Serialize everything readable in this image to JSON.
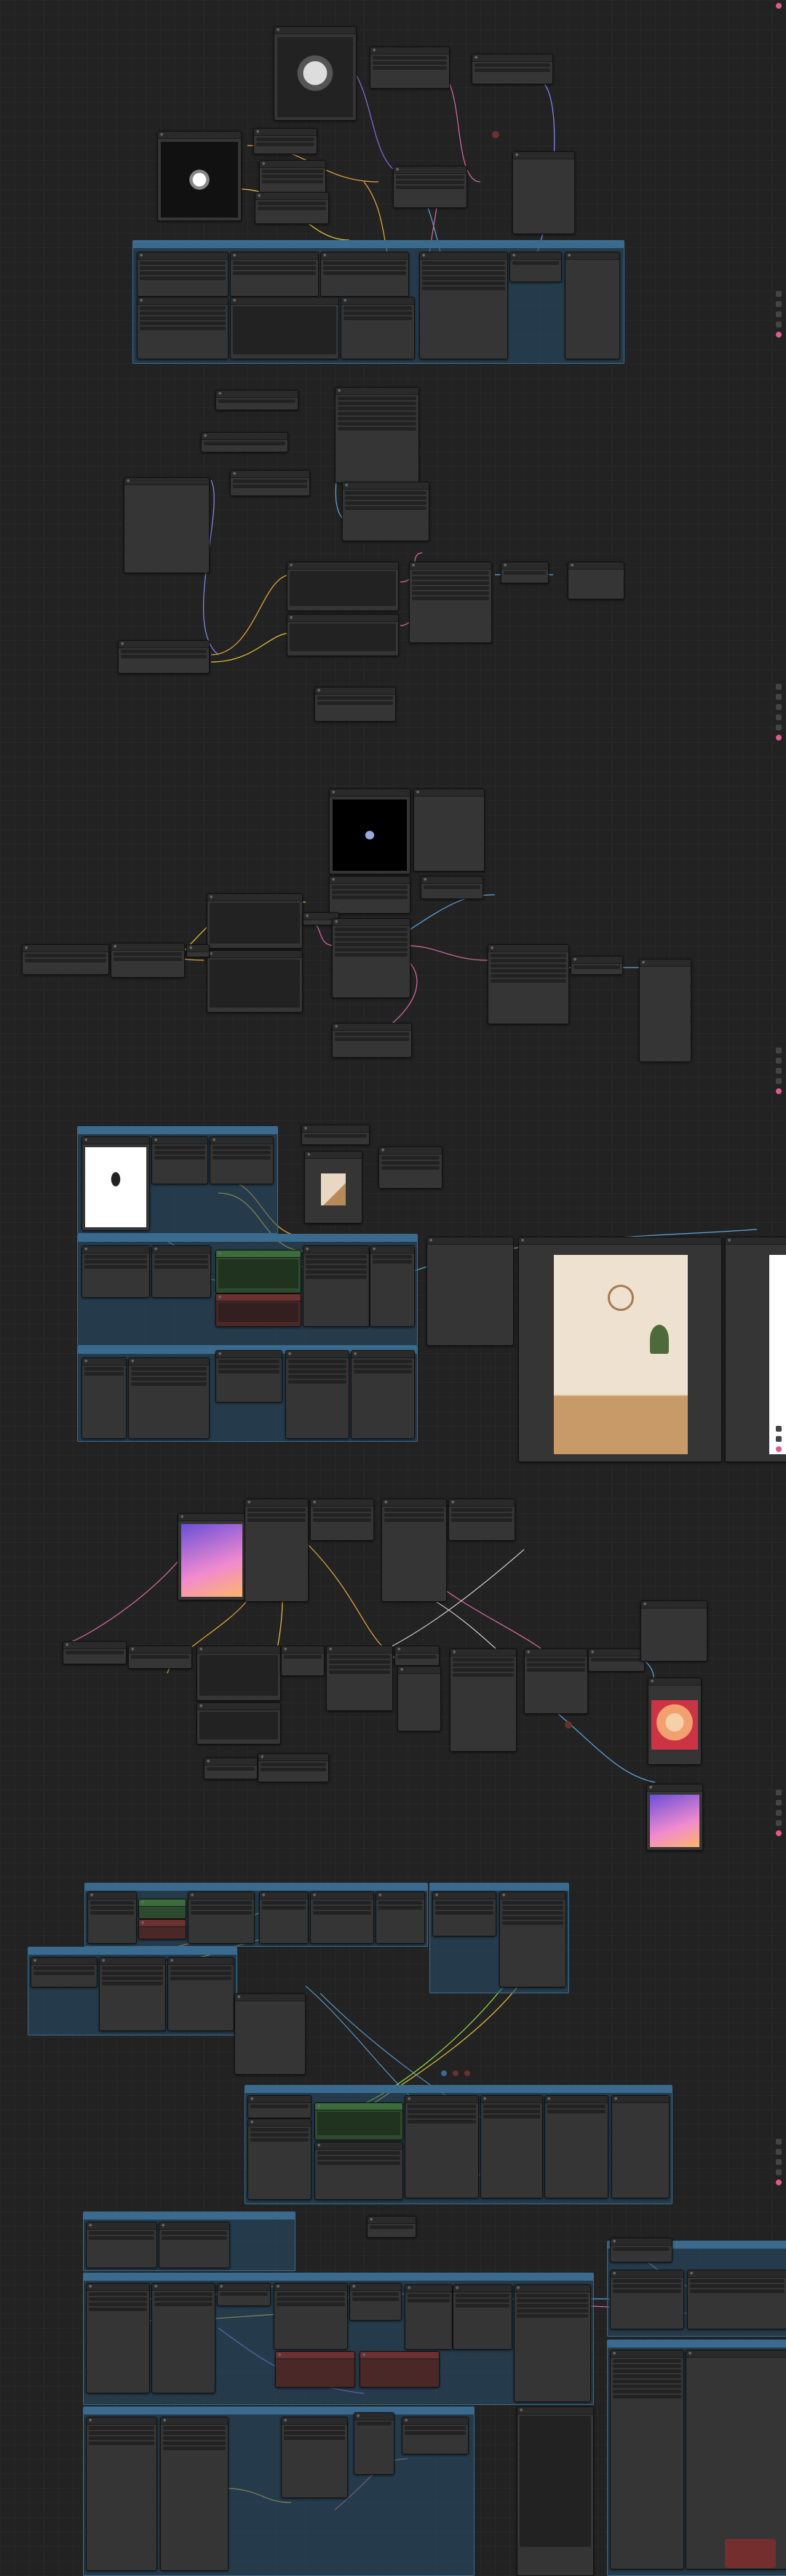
{
  "app": {
    "title": "",
    "theme_colors": {
      "canvas": "#222222",
      "node": "#353535",
      "group": "#3a6b8e",
      "accent_pink": "#d95c8c",
      "output_green": "#4a8a4a",
      "error_red": "#6b3030"
    }
  },
  "sections": [
    {
      "id": "workflow-1",
      "label": ""
    },
    {
      "id": "workflow-2",
      "label": ""
    },
    {
      "id": "workflow-3",
      "label": ""
    },
    {
      "id": "workflow-4",
      "label": ""
    },
    {
      "id": "workflow-5",
      "label": ""
    },
    {
      "id": "workflow-6",
      "label": ""
    },
    {
      "id": "workflow-7",
      "label": ""
    }
  ],
  "toolbar": {
    "icons": [
      "fit-view-icon",
      "zoom-in-icon",
      "zoom-out-icon",
      "lock-icon",
      "link-toggle-icon",
      "minimap-icon"
    ]
  },
  "preview_images": [
    {
      "name": "watch-product-image",
      "colors": [
        "#ddd",
        "#222"
      ]
    },
    {
      "name": "watch-white-product-image",
      "colors": [
        "#fff",
        "#333"
      ]
    },
    {
      "name": "dark-figure-image",
      "colors": [
        "#000",
        "#9ad"
      ]
    },
    {
      "name": "microphone-image",
      "colors": [
        "#fff",
        "#222"
      ]
    },
    {
      "name": "room-interior-image",
      "colors": [
        "#e8d7c2",
        "#b78a5c"
      ]
    },
    {
      "name": "fan-room-render-image",
      "colors": [
        "#e6d4bf",
        "#a77b50"
      ]
    },
    {
      "name": "colorful-city-image",
      "colors": [
        "#6a4fd8",
        "#f18ad0"
      ]
    },
    {
      "name": "cartoon-orange-image",
      "colors": [
        "#f2a070",
        "#c34"
      ]
    },
    {
      "name": "colorful-city-image-2",
      "colors": [
        "#6a4fd8",
        "#f18ad0"
      ]
    }
  ]
}
